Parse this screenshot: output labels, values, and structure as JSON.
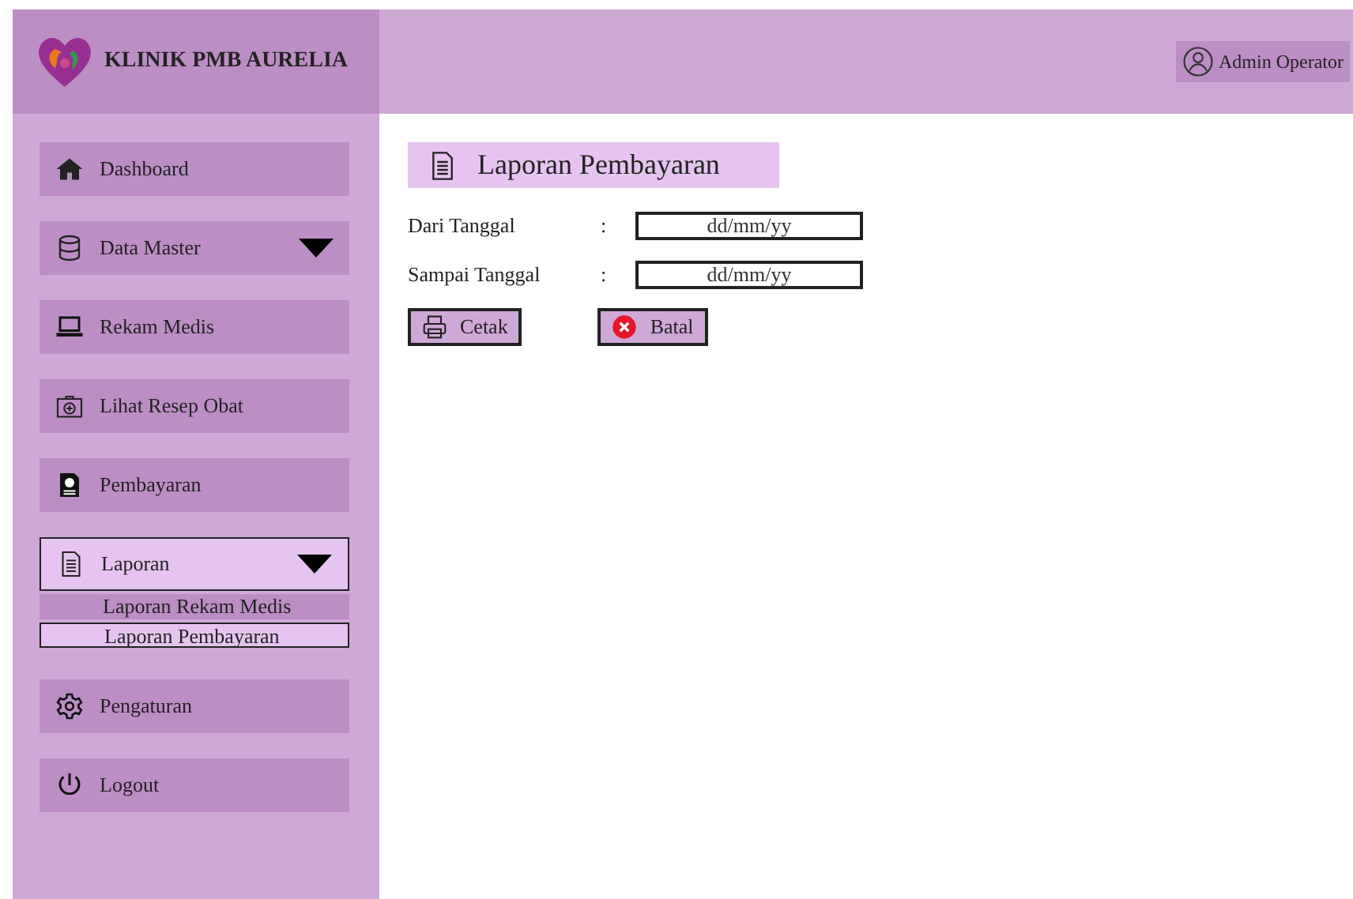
{
  "header": {
    "brand": "KLINIK PMB AURELIA",
    "user": "Admin Operator"
  },
  "sidebar": {
    "items": [
      {
        "label": "Dashboard",
        "kind": "link",
        "selected": false
      },
      {
        "label": "Data Master",
        "kind": "dropdown",
        "selected": false
      },
      {
        "label": "Rekam Medis",
        "kind": "link",
        "selected": false
      },
      {
        "label": "Lihat Resep Obat",
        "kind": "link",
        "selected": false
      },
      {
        "label": "Pembayaran",
        "kind": "link",
        "selected": false
      },
      {
        "label": "Laporan",
        "kind": "dropdown",
        "selected": true,
        "children": [
          {
            "label": "Laporan Rekam Medis",
            "selected": false
          },
          {
            "label": "Laporan Pembayaran",
            "selected": true
          }
        ]
      },
      {
        "label": "Pengaturan",
        "kind": "link",
        "selected": false
      },
      {
        "label": "Logout",
        "kind": "link",
        "selected": false
      }
    ]
  },
  "main": {
    "title": "Laporan Pembayaran",
    "fields": [
      {
        "label": "Dari Tanggal",
        "separator": ":",
        "placeholder": "dd/mm/yy"
      },
      {
        "label": "Sampai Tanggal",
        "separator": ":",
        "placeholder": "dd/mm/yy"
      }
    ],
    "buttons": [
      {
        "label": "Cetak",
        "kind": "print"
      },
      {
        "label": "Batal",
        "kind": "cancel"
      }
    ]
  }
}
